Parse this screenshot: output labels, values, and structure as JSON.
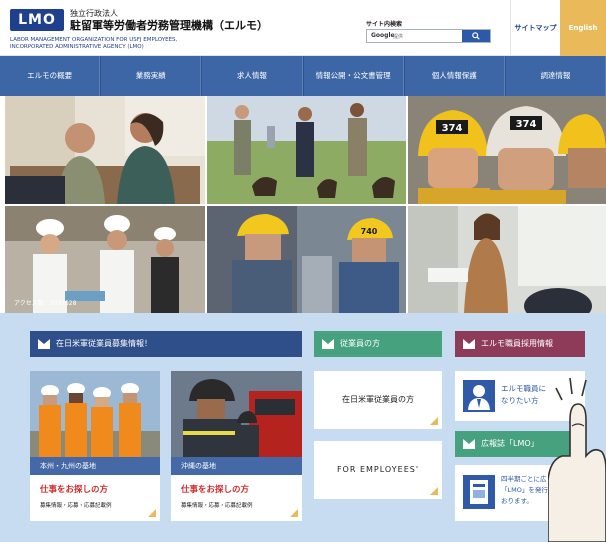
{
  "header": {
    "logo": "LMO",
    "org_small": "独立行政法人",
    "org_main": "駐留軍等労働者労務管理機構（エルモ）",
    "org_en_line1": "LABOR MANAGEMENT ORGANIZATION FOR USFJ EMPLOYEES,",
    "org_en_line2": "INCORPORATED ADMINISTRATIVE AGENCY (LMO)",
    "search_title": "サイト内検索",
    "search_brand": "Google",
    "search_placeholder": "提供",
    "sitemap": "サイトマップ",
    "english": "English"
  },
  "nav": {
    "items": [
      "エルモの概要",
      "業務実績",
      "求人情報",
      "情報公開・公文書管理",
      "個人情報保護",
      "調達情報"
    ]
  },
  "hero": {
    "access_label": "アクセス数：5097528",
    "helmet_numbers": [
      "374",
      "374",
      "740"
    ]
  },
  "sections": {
    "recruit_header": "在日米軍従業員募集情報！",
    "employees_header": "従業員の方",
    "staff_header": "エルモ職員採用情報",
    "magazine_header": "広報誌「LMO」"
  },
  "cards": {
    "honshu": {
      "band": "本州・九州の基地",
      "title": "仕事をお探しの方",
      "sub": "募集情報・応募・応募記載例"
    },
    "okinawa": {
      "band": "沖縄の基地",
      "title": "仕事をお探しの方",
      "sub": "募集情報・応募・応募記載例"
    }
  },
  "buttons": {
    "usfj_employees": "在日米軍従業員の方",
    "for_employees": "FOR EMPLOYEES'"
  },
  "staff_card": {
    "line1": "エルモ職員に",
    "line2": "なりたい方"
  },
  "magazine_card": {
    "line1": "四半期ごとに広",
    "line2": "「LMO」を発行し",
    "line3": "おります。"
  },
  "colors": {
    "nav": "#3c66a5",
    "english_tab": "#e9b95a",
    "recruit": "#2f4f8a",
    "employees": "#46a17f",
    "staff": "#8e3b59",
    "background": "#c8dcf1"
  }
}
